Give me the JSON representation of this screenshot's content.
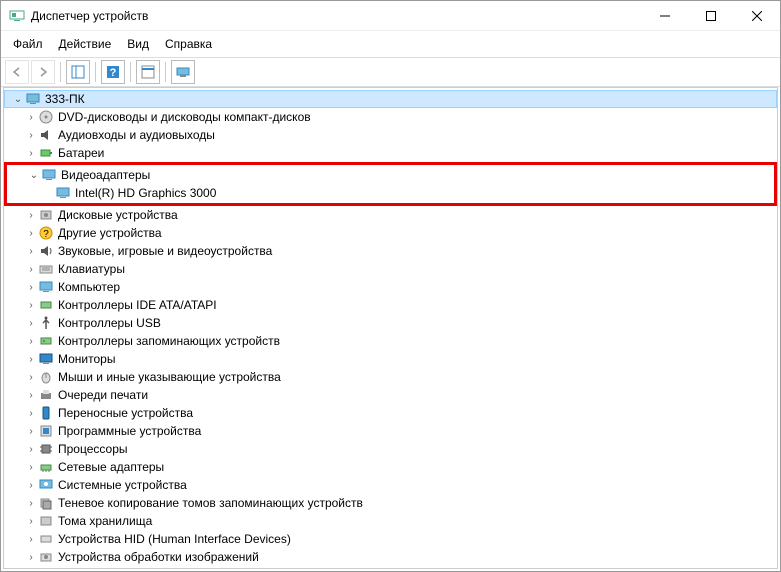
{
  "window": {
    "title": "Диспетчер устройств"
  },
  "menu": {
    "file": "Файл",
    "action": "Действие",
    "view": "Вид",
    "help": "Справка"
  },
  "tree": {
    "root": "333-ПК",
    "dvd": "DVD-дисководы и дисководы компакт-дисков",
    "audio": "Аудиовходы и аудиовыходы",
    "batteries": "Батареи",
    "video_adapters": "Видеоадаптеры",
    "video_child": "Intel(R) HD Graphics 3000",
    "disk": "Дисковые устройства",
    "other": "Другие устройства",
    "sound": "Звуковые, игровые и видеоустройства",
    "keyboards": "Клавиатуры",
    "computer": "Компьютер",
    "ide": "Контроллеры IDE ATA/ATAPI",
    "usb": "Контроллеры USB",
    "storage_ctrl": "Контроллеры запоминающих устройств",
    "monitors": "Мониторы",
    "mice": "Мыши и иные указывающие устройства",
    "printq": "Очереди печати",
    "portable": "Переносные устройства",
    "software": "Программные устройства",
    "cpu": "Процессоры",
    "network": "Сетевые адаптеры",
    "system": "Системные устройства",
    "shadow": "Теневое копирование томов запоминающих устройств",
    "volumes": "Тома хранилища",
    "hid": "Устройства HID (Human Interface Devices)",
    "imaging": "Устройства обработки изображений"
  }
}
